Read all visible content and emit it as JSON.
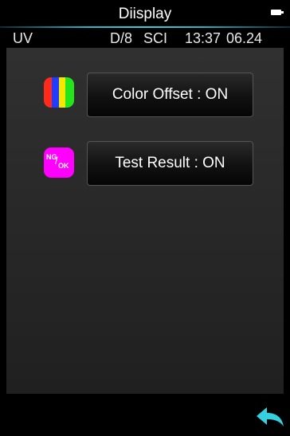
{
  "header": {
    "title": "Diisplay",
    "battery_icon": "battery-icon",
    "accent_color": "#34d0e0"
  },
  "status_bar": {
    "mode": "UV",
    "geometry": "D/8",
    "spec_mode": "SCI",
    "time": "13:37",
    "date": "06.24"
  },
  "settings": [
    {
      "label": "Color Offset : ON",
      "icon": "color-bars-icon",
      "icon_colors": [
        "#ff2a1a",
        "#1f3cff",
        "#f5e800",
        "#22e51b"
      ]
    },
    {
      "label": "Test Result : ON",
      "icon": "ng-ok-icon",
      "icon_text_top": "NG",
      "icon_text_slash": "/",
      "icon_text_bottom": "OK",
      "icon_color": "#ff00ff"
    }
  ],
  "footer": {
    "back_icon": "back-arrow-icon",
    "back_color": "#34d0e0"
  }
}
